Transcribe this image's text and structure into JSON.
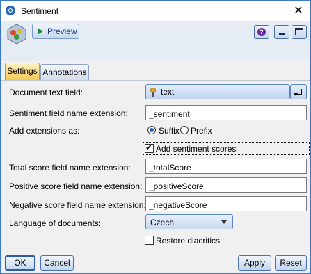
{
  "window": {
    "title": "Sentiment"
  },
  "toolbar": {
    "preview_label": "Preview"
  },
  "tabs": [
    {
      "label": "Settings",
      "active": true
    },
    {
      "label": "Annotations",
      "active": false
    }
  ],
  "form": {
    "document_text_field": {
      "label": "Document text field:",
      "value": "text"
    },
    "sentiment_ext": {
      "label": "Sentiment field name extension:",
      "value": "_sentiment"
    },
    "add_extensions": {
      "label": "Add extensions as:",
      "options": [
        "Suffix",
        "Prefix"
      ],
      "selected": "Suffix"
    },
    "add_sentiment_scores": {
      "label": "Add sentiment scores",
      "checked": true
    },
    "total_score_ext": {
      "label": "Total score field name extension:",
      "value": "_totalScore"
    },
    "positive_score_ext": {
      "label": "Positive score field name extension:",
      "value": "_positiveScore"
    },
    "negative_score_ext": {
      "label": "Negative score field name extension:",
      "value": "_negativeScore"
    },
    "language": {
      "label": "Language of documents:",
      "value": "Czech"
    },
    "restore_diacritics": {
      "label": "Restore diacritics",
      "checked": false
    }
  },
  "buttons": {
    "ok": "OK",
    "cancel": "Cancel",
    "apply": "Apply",
    "reset": "Reset"
  },
  "icons": {
    "app": "sentiment-node-icon",
    "close": "close-icon",
    "help": "help-icon",
    "minimize": "minimize-icon",
    "maximize": "maximize-icon",
    "field": "field-pin-icon",
    "picker": "field-picker-icon"
  },
  "colors": {
    "accent": "#2b6cc4",
    "active_tab": "#f6c850",
    "title_bar": "#ffffff",
    "toolbar": "#e6ecf4"
  }
}
